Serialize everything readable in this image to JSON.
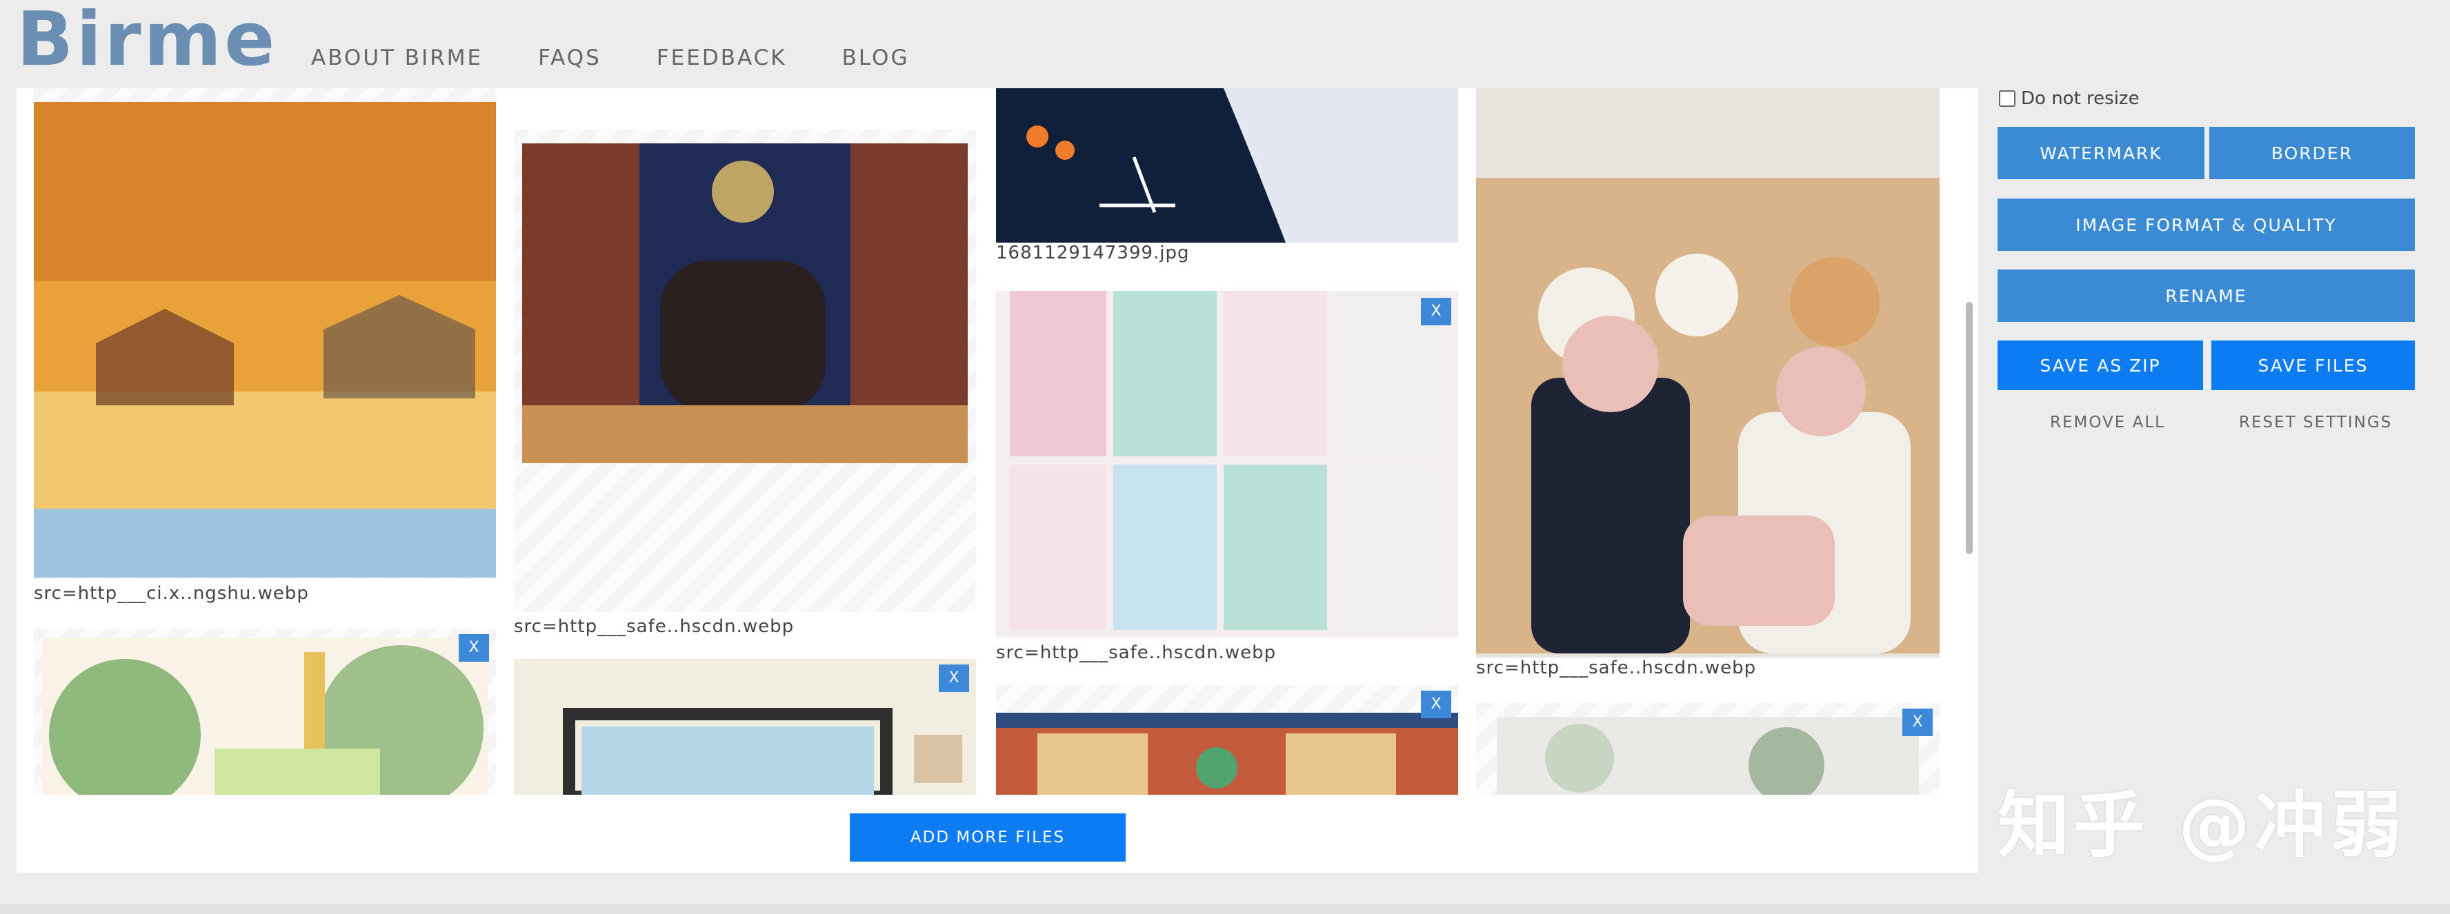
{
  "logo": "Birme",
  "nav": [
    "ABOUT BIRME",
    "FAQS",
    "FEEDBACK",
    "BLOG"
  ],
  "gallery": {
    "remove_label": "X",
    "add_more_label": "ADD MORE FILES",
    "tiles": [
      {
        "filename": "src=http___ci.x..ngshu.webp",
        "colors": [
          "#e9a23a",
          "#c86a1f",
          "#f3d27a",
          "#9fc4e0"
        ]
      },
      {
        "filename": "",
        "colors": [
          "#cfe6a0",
          "#e6c15c",
          "#6ea55b",
          "#f8f3e6"
        ]
      },
      {
        "filename": "src=http___safe..hscdn.webp",
        "colors": [
          "#1f2a55",
          "#7a3a2c",
          "#c69153",
          "#e7c469"
        ]
      },
      {
        "filename": "",
        "colors": [
          "#f2ede1",
          "#2f2f2f",
          "#b6d7e7",
          "#d9c3a5"
        ]
      },
      {
        "filename": "1681129147399.jpg",
        "colors": [
          "#10203a",
          "#e3e7ef",
          "#f07b2a",
          "#ffffff"
        ]
      },
      {
        "filename": "src=http___safe..hscdn.webp",
        "colors": [
          "#f1c9d4",
          "#b8e0d6",
          "#c7e3f0",
          "#f5e3e8"
        ]
      },
      {
        "filename": "",
        "colors": [
          "#c35b3c",
          "#e8c48f",
          "#52a46f",
          "#2f4c7f"
        ]
      },
      {
        "filename": "src=http___safe..hscdn.webp",
        "colors": [
          "#d9b48a",
          "#1e2433",
          "#e9bfb8",
          "#7f5136"
        ]
      },
      {
        "filename": "",
        "colors": [
          "#e9e9e6",
          "#c9d5c3",
          "#a5b79e",
          "#f4f4f2"
        ]
      }
    ]
  },
  "panel": {
    "do_not_resize": "Do not resize",
    "watermark": "WATERMARK",
    "border": "BORDER",
    "format": "IMAGE FORMAT & QUALITY",
    "rename": "RENAME",
    "save_zip": "SAVE AS ZIP",
    "save_files": "SAVE FILES",
    "remove_all": "REMOVE ALL",
    "reset": "RESET SETTINGS"
  },
  "site_watermark": "知乎 @冲弱"
}
